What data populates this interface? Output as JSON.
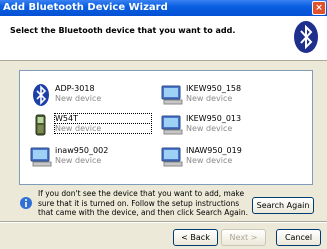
{
  "window": {
    "title": "Add Bluetooth Device Wizard",
    "close_glyph": "×"
  },
  "header": {
    "instruction": "Select the Bluetooth device that you want to add."
  },
  "devices": [
    {
      "name": "ADP-3018",
      "status": "New device",
      "icon": "bluetooth-icon"
    },
    {
      "name": "IKEW950_158",
      "status": "New device",
      "icon": "computer-icon"
    },
    {
      "name": "W54T",
      "status": "New device",
      "icon": "phone-icon",
      "focused": true
    },
    {
      "name": "IKEW950_013",
      "status": "New device",
      "icon": "computer-icon"
    },
    {
      "name": "inaw950_002",
      "status": "New device",
      "icon": "computer-icon"
    },
    {
      "name": "INAW950_019",
      "status": "New device",
      "icon": "computer-icon"
    }
  ],
  "info": {
    "text": "If you don't see the device that you want to add, make sure that it is turned on. Follow the setup instructions that came with the device, and then click Search Again."
  },
  "buttons": {
    "search_again": "Search Again",
    "back": "< Back",
    "next": "Next >",
    "cancel": "Cancel"
  },
  "colors": {
    "titlebar": "#0a5fe0",
    "dialog_bg": "#ece9d8",
    "close": "#e0512d"
  }
}
